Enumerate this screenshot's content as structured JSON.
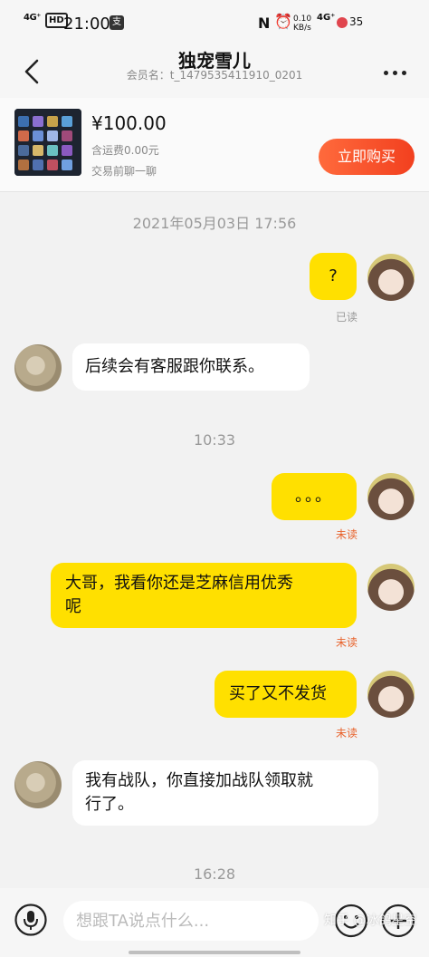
{
  "status_bar": {
    "signal": "4G⁺",
    "hd": "HD",
    "time": "21:00",
    "app_icon_glyph": "支",
    "speed_top": "0.10",
    "speed_bottom": "KB/s",
    "network": "4G⁺",
    "battery": "35"
  },
  "header": {
    "title": "独宠雪儿",
    "member": "会员名：t_1479535411910_0201"
  },
  "product": {
    "price": "¥100.00",
    "shipping": "含运费0.00元",
    "note": "交易前聊一聊",
    "buy_label": "立即购买"
  },
  "messages": {
    "ts1": "2021年05月03日 17:56",
    "m1": {
      "text": "?",
      "status": "已读"
    },
    "m2": {
      "text": "后续会有客服跟你联系。"
    },
    "ts2": "10:33",
    "m3": {
      "text": "。。。",
      "status": "未读"
    },
    "m4": {
      "line1": "大哥，我看你还是芝麻信用优秀",
      "line2": "呢",
      "status": "未读"
    },
    "m5": {
      "text": "买了又不发货",
      "status": "未读"
    },
    "m6": {
      "line1": "我有战队，你直接加战队领取就",
      "line2": "行了。"
    },
    "ts3": "16:28"
  },
  "input_bar": {
    "placeholder": "想跟TA说点什么...",
    "watermark": "知乎 @冰鸽星空"
  },
  "colors": {
    "bubble_me": "#ffe000",
    "buy_button": "#f2401f",
    "unread": "#e8632c"
  },
  "icons": [
    "back-arrow-icon",
    "more-dots-icon",
    "microphone-icon",
    "emoji-icon",
    "plus-icon"
  ]
}
